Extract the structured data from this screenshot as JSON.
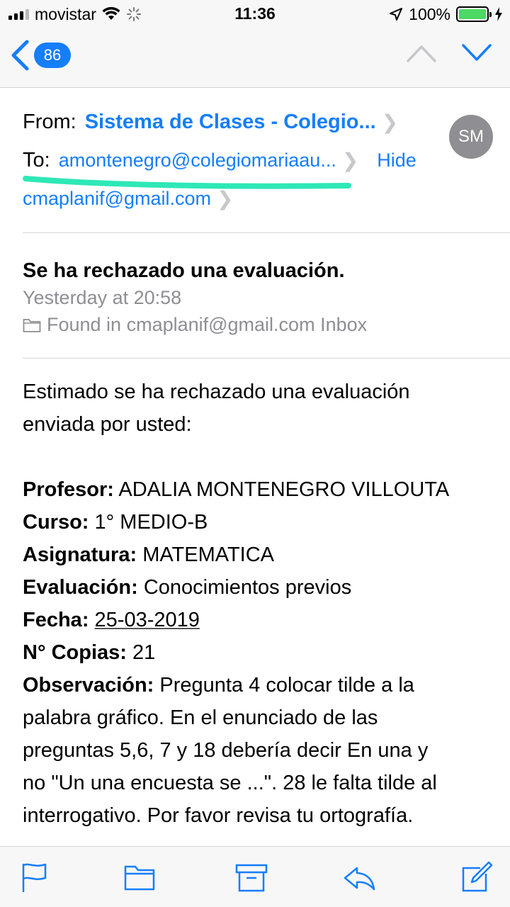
{
  "status_bar": {
    "carrier": "movistar",
    "time": "11:36",
    "battery": "100%"
  },
  "nav": {
    "unread_count": "86"
  },
  "header": {
    "from_label": "From:",
    "from_value": "Sistema de Clases - Colegio...",
    "to_label": "To:",
    "to_value": "amontenegro@colegiomariaau...",
    "hide_label": "Hide",
    "cc_value": "cmaplanif@gmail.com",
    "avatar_initials": "SM"
  },
  "message": {
    "subject": "Se ha rechazado una evaluación.",
    "datetime": "Yesterday at 20:58",
    "found_in": "Found in cmaplanif@gmail.com Inbox",
    "intro_line1": "Estimado se ha rechazado una evaluación",
    "intro_line2": "enviada por usted:",
    "fields": {
      "profesor_label": "Profesor:",
      "profesor_value": "ADALIA MONTENEGRO VILLOUTA",
      "curso_label": "Curso:",
      "curso_value": "1° MEDIO-B",
      "asignatura_label": "Asignatura:",
      "asignatura_value": "MATEMATICA",
      "evaluacion_label": "Evaluación:",
      "evaluacion_value": "Conocimientos previos",
      "fecha_label": "Fecha:",
      "fecha_value": "25-03-2019",
      "copias_label": "N° Copias:",
      "copias_value": "21",
      "observacion_label": "Observación:",
      "observacion_line1": "Pregunta 4 colocar tilde a la",
      "observacion_line2": "palabra gráfico. En el enunciado de las",
      "observacion_line3": "preguntas 5,6, 7 y 18 debería decir En una y",
      "observacion_line4": "no \"Un una encuesta se ...\". 28 le falta tilde al",
      "observacion_line5": "interrogativo. Por favor revisa tu ortografía."
    }
  },
  "toolbar": {
    "icons": [
      "flag-icon",
      "folder-icon",
      "archive-icon",
      "reply-icon",
      "compose-icon"
    ]
  },
  "colors": {
    "accent": "#157efb",
    "highlight": "#2ee8b6",
    "battery": "#4cd964"
  }
}
